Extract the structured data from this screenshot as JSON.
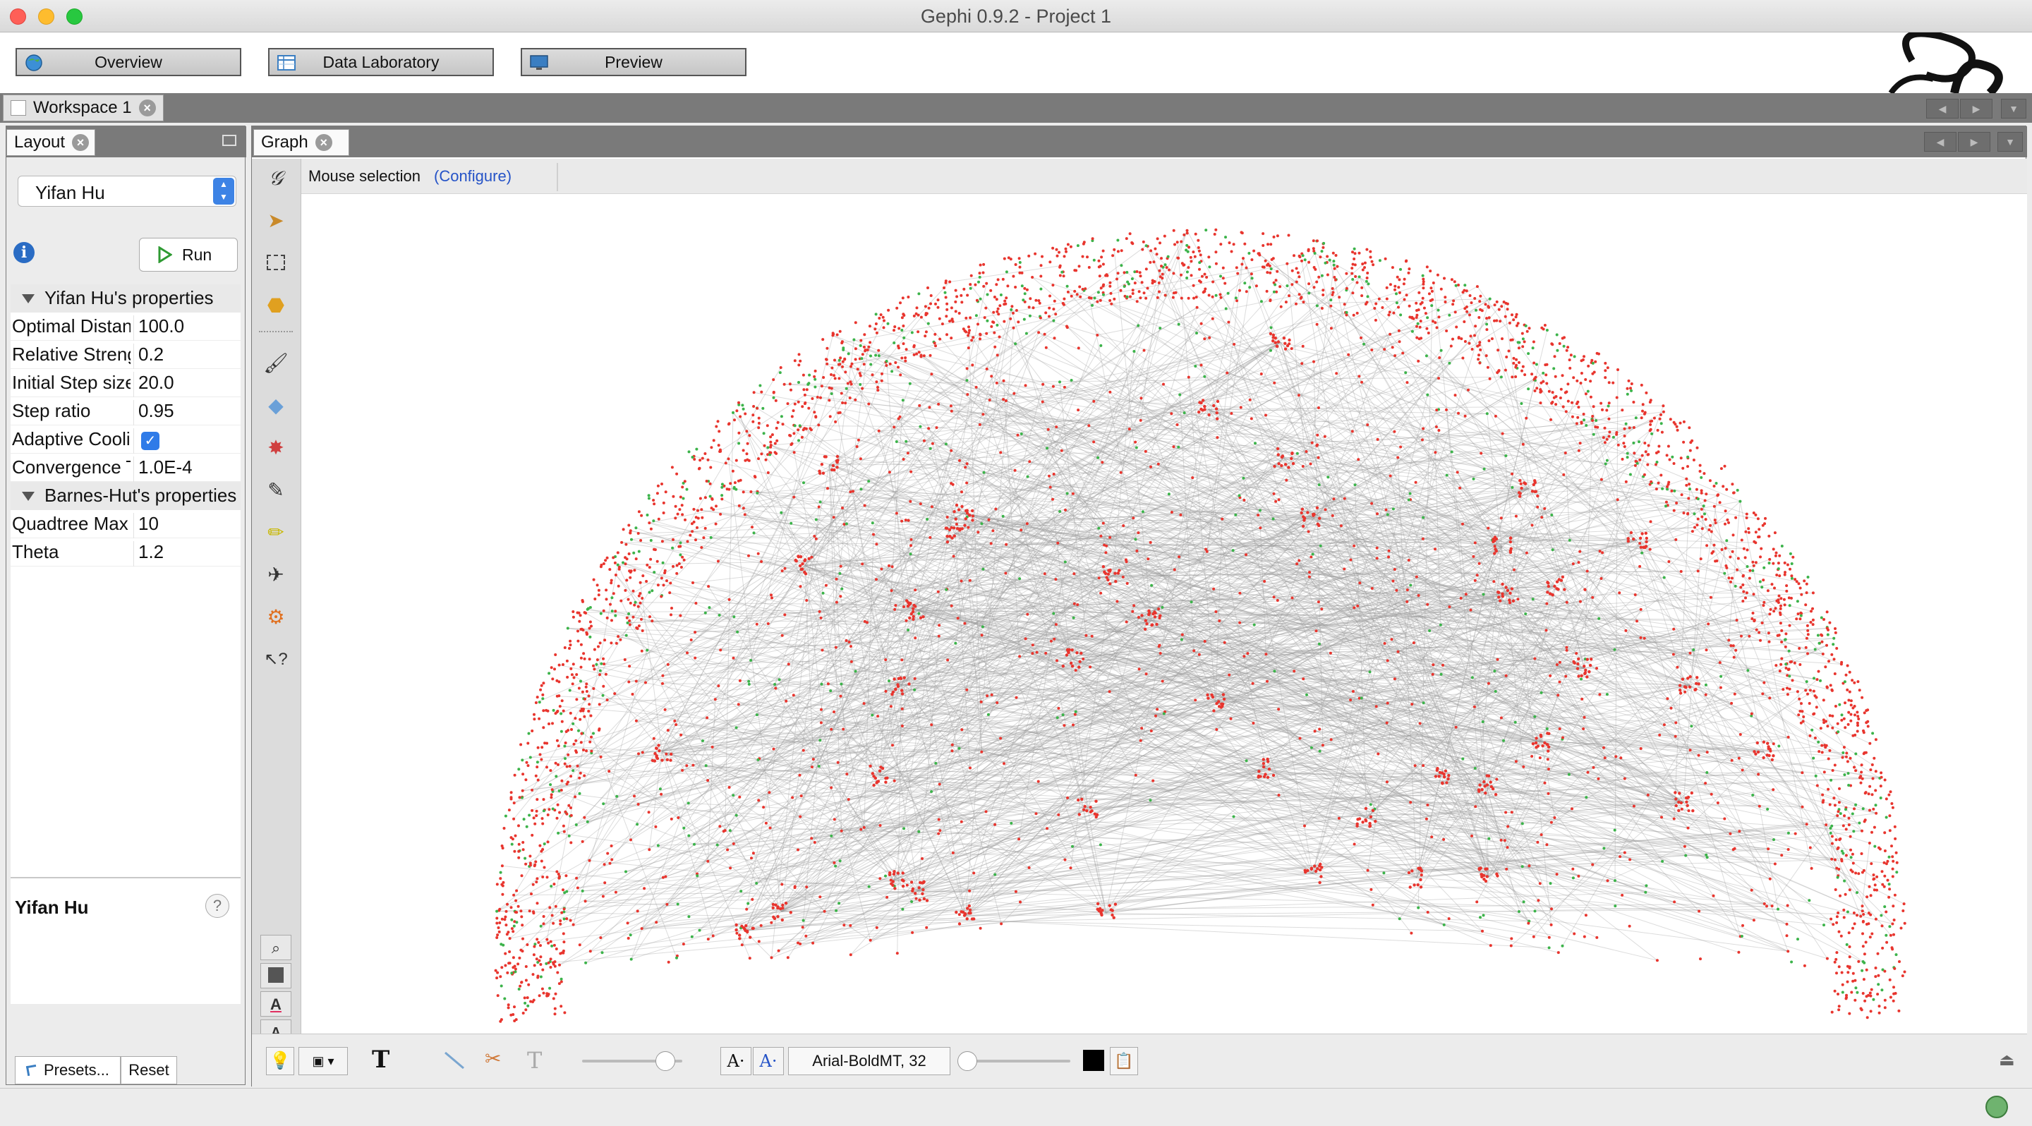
{
  "window": {
    "title": "Gephi 0.9.2 - Project 1"
  },
  "modes": [
    {
      "label": "Overview",
      "icon": "globe-icon"
    },
    {
      "label": "Data Laboratory",
      "icon": "table-icon"
    },
    {
      "label": "Preview",
      "icon": "monitor-icon"
    }
  ],
  "workspace_tab": {
    "label": "Workspace 1"
  },
  "layout_panel": {
    "tab_label": "Layout",
    "algorithm": "Yifan Hu",
    "run_label": "Run",
    "sections": [
      {
        "title": "Yifan Hu's properties",
        "rows": [
          {
            "key": "Optimal Distance",
            "value": "100.0"
          },
          {
            "key": "Relative Strength",
            "value": "0.2"
          },
          {
            "key": "Initial Step size",
            "value": "20.0"
          },
          {
            "key": "Step ratio",
            "value": "0.95"
          },
          {
            "key": "Adaptive Cooling",
            "value": ""
          },
          {
            "key": "Convergence Threshold",
            "value": "1.0E-4"
          }
        ]
      },
      {
        "title": "Barnes-Hut's properties",
        "rows": [
          {
            "key": "Quadtree Max Level",
            "value": "10"
          },
          {
            "key": "Theta",
            "value": "1.2"
          }
        ]
      }
    ],
    "description_title": "Yifan Hu",
    "presets_label": "Presets...",
    "reset_label": "Reset"
  },
  "graph_panel": {
    "tab_label": "Graph",
    "mouse_selection": "Mouse selection",
    "configure_link": "(Configure)",
    "font_label": "Arial-BoldMT, 32",
    "node_colors": {
      "primary": "#e8352e",
      "secondary": "#3cb34a",
      "edge": "#9a9a9a"
    },
    "tool_icons": [
      "gephi-logo-icon",
      "pointer-icon",
      "rectangle-select-icon",
      "lasso-icon",
      "brush-icon",
      "diamond-icon",
      "painter-icon",
      "pencil-icon",
      "highlighter-icon",
      "plane-icon",
      "gear-icon",
      "help-cursor-icon"
    ]
  }
}
